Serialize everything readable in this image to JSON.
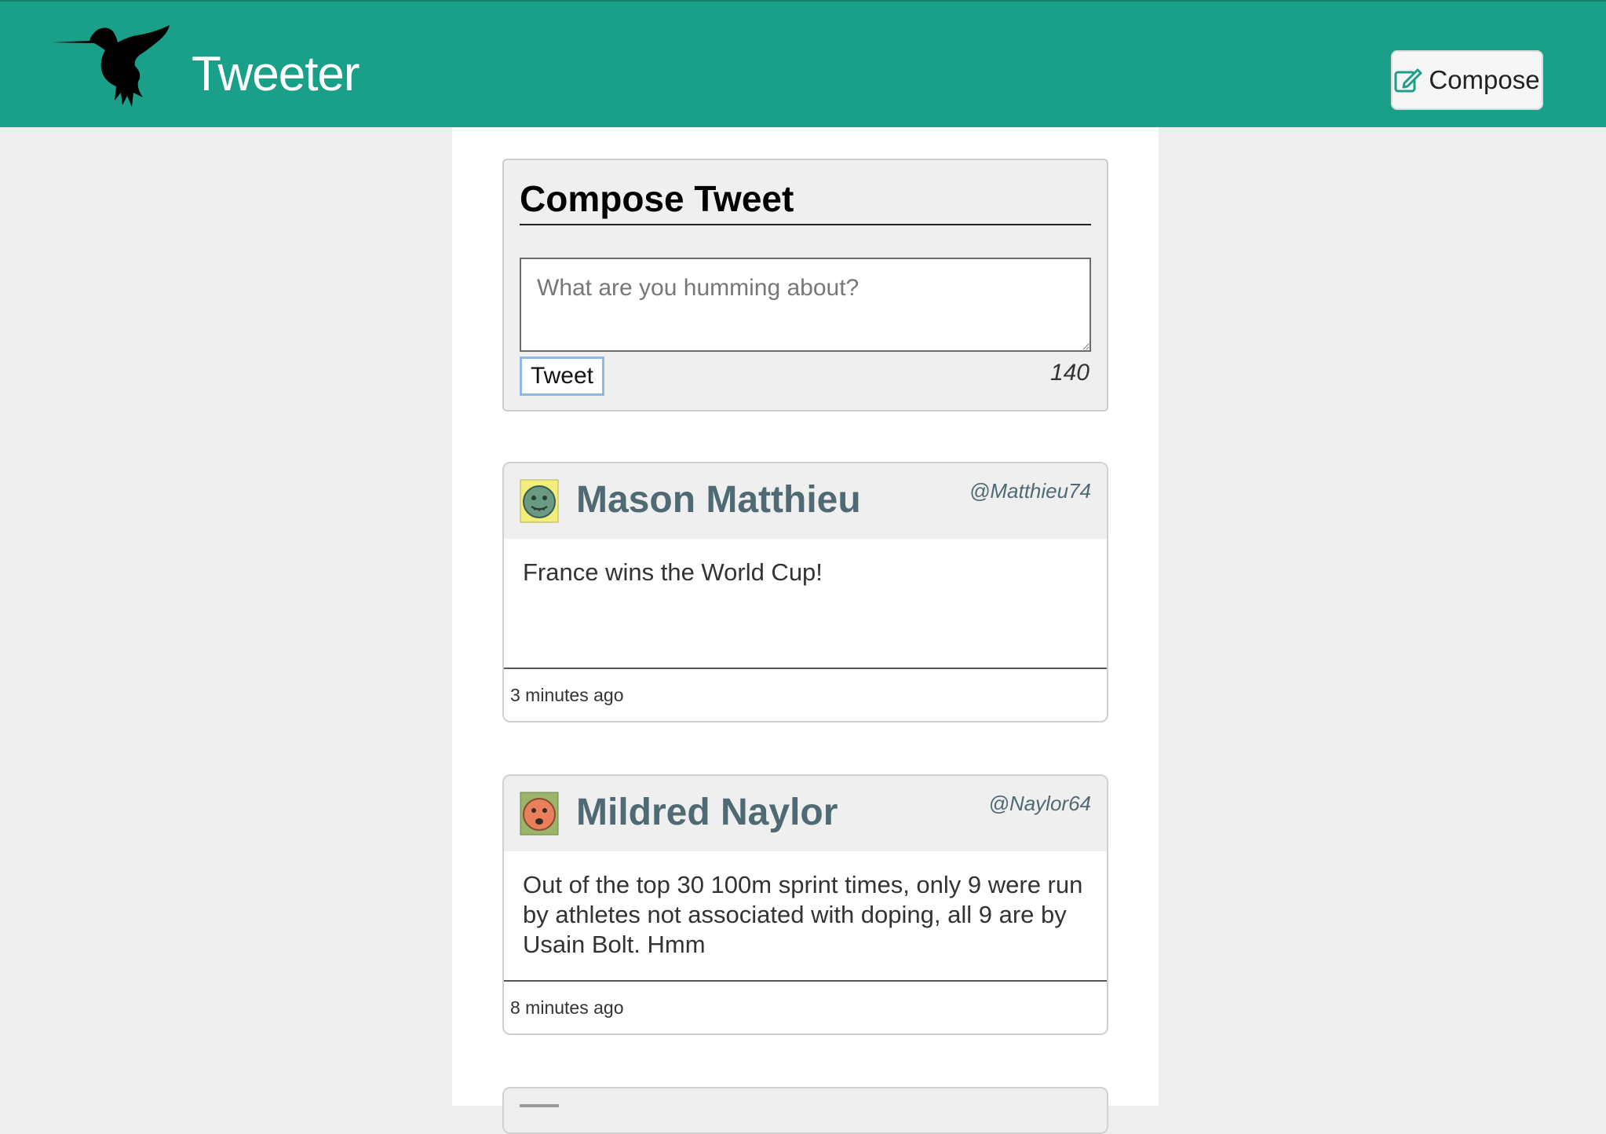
{
  "navbar": {
    "brand": "Tweeter",
    "compose_label": "Compose",
    "background_color": "#1aa088"
  },
  "new_tweet": {
    "title": "Compose Tweet",
    "placeholder": "What are you humming about?",
    "value": "",
    "button_label": "Tweet",
    "char_counter": "140"
  },
  "tweets": [
    {
      "name": "Mason Matthieu",
      "handle": "@Matthieu74",
      "content": "France wins the World Cup!",
      "time": "3 minutes ago",
      "avatar_bg": "#f3ee7a",
      "avatar_face": "#6a9a82"
    },
    {
      "name": "Mildred Naylor",
      "handle": "@Naylor64",
      "content": "Out of the top 30 100m sprint times, only 9 were run by athletes not associated with doping, all 9 are by Usain Bolt. Hmm",
      "time": "8 minutes ago",
      "avatar_bg": "#9ab46a",
      "avatar_face": "#e8805c"
    }
  ]
}
